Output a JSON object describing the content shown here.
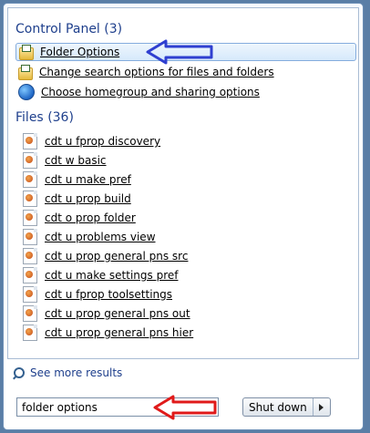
{
  "control_panel": {
    "title": "Control Panel",
    "count": "(3)",
    "items": [
      {
        "label": "Folder Options",
        "icon": "folder-options-icon",
        "selected": true
      },
      {
        "label": "Change search options for files and folders",
        "icon": "folder-options-icon"
      },
      {
        "label": "Choose homegroup and sharing options",
        "icon": "homegroup-icon"
      }
    ]
  },
  "files": {
    "title": "Files",
    "count": "(36)",
    "items": [
      "cdt u fprop discovery",
      "cdt w basic",
      "cdt u make pref",
      "cdt u prop build",
      "cdt o prop folder",
      "cdt u problems view",
      "cdt u prop general pns src",
      "cdt u make settings pref",
      "cdt u fprop toolsettings",
      "cdt u prop general pns out",
      "cdt u prop general pns hier"
    ]
  },
  "see_more": "See more results",
  "search": {
    "value": "folder options"
  },
  "shutdown": {
    "label": "Shut down"
  },
  "annotation_colors": {
    "blue_arrow": "#2f3fd0",
    "red_arrow": "#e01a1a"
  }
}
